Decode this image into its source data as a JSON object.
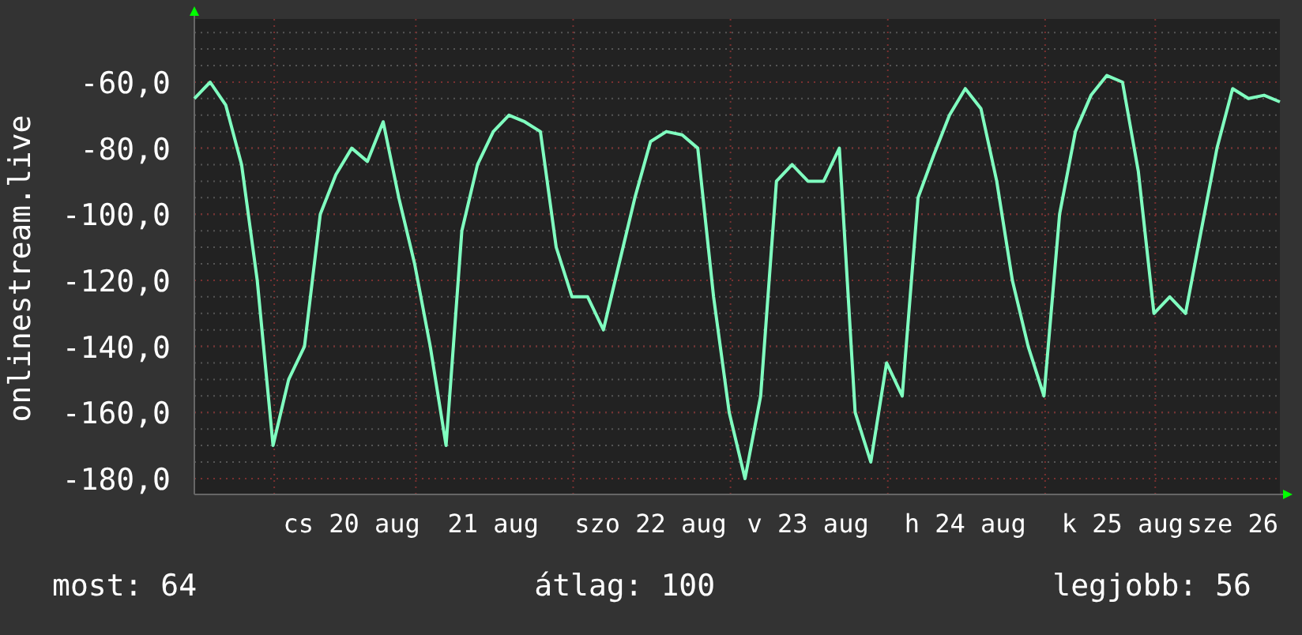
{
  "chart": {
    "chart_data": {
      "type": "line",
      "ylabel": "onlinestream.live",
      "categories": [
        null,
        null,
        null,
        null,
        null,
        null,
        null,
        null,
        null,
        null,
        "cs 20 aug",
        null,
        null,
        null,
        null,
        null,
        null,
        null,
        null,
        "21 aug",
        null,
        null,
        null,
        null,
        null,
        null,
        null,
        null,
        null,
        "szo 22 aug",
        null,
        null,
        null,
        null,
        null,
        null,
        null,
        null,
        null,
        "v 23 aug",
        null,
        null,
        null,
        null,
        null,
        null,
        null,
        null,
        null,
        "h 24 aug",
        null,
        null,
        null,
        null,
        null,
        null,
        null,
        null,
        null,
        "k 25 aug",
        null,
        null,
        null,
        null,
        null,
        null,
        "sze 26",
        null,
        null,
        null
      ],
      "yticks": [
        {
          "value": -60,
          "label": "-60,0"
        },
        {
          "value": -80,
          "label": "-80,0"
        },
        {
          "value": -100,
          "label": "-100,0"
        },
        {
          "value": -120,
          "label": "-120,0"
        },
        {
          "value": -140,
          "label": "-140,0"
        },
        {
          "value": -160,
          "label": "-160,0"
        },
        {
          "value": -180,
          "label": "-180,0"
        }
      ],
      "ylim": [
        -184.8,
        -40.9
      ],
      "grid": true,
      "series": [
        {
          "color": "#80ffc0",
          "values": [
            -65,
            -60,
            -67,
            -85,
            -120,
            -170,
            -150,
            -140,
            -100,
            -88,
            -80,
            -84,
            -72,
            -95,
            -115,
            -140,
            -170,
            -105,
            -85,
            -75,
            -70,
            -72,
            -75,
            -110,
            -125,
            -125,
            -135,
            -115,
            -95,
            -78,
            -75,
            -76,
            -80,
            -125,
            -160,
            -180,
            -155,
            -90,
            -85,
            -90,
            -90,
            -80,
            -160,
            -175,
            -145,
            -155,
            -95,
            -82,
            -70,
            -62,
            -68,
            -90,
            -120,
            -140,
            -155,
            -100,
            -75,
            -64,
            -58,
            -60,
            -87,
            -130,
            -125,
            -130,
            -105,
            -80,
            -62,
            -65,
            -64,
            -66
          ]
        }
      ]
    }
  },
  "stats": [
    "most: 64",
    "átlag: 100",
    "legjobb: 56"
  ]
}
